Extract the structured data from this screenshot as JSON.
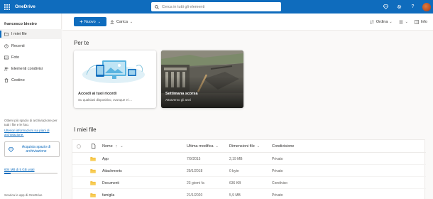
{
  "topbar": {
    "app_name": "OneDrive",
    "search_placeholder": "Cerca in tutti gli elementi",
    "icons": [
      "diamond-icon",
      "gear-icon",
      "help-icon",
      "avatar"
    ],
    "help_label": "?"
  },
  "sidebar": {
    "user_name": "francesco biestro",
    "items": [
      {
        "label": "I miei file",
        "icon": "folder-icon",
        "active": true
      },
      {
        "label": "Recenti",
        "icon": "clock-icon",
        "active": false
      },
      {
        "label": "Foto",
        "icon": "photo-icon",
        "active": false
      },
      {
        "label": "Elementi condivisi",
        "icon": "people-icon",
        "active": false
      },
      {
        "label": "Cestino",
        "icon": "trash-icon",
        "active": false
      }
    ],
    "storage_text": "Ottieni più spazio di archiviazione per tutti i file e le foto.",
    "storage_link": "Ulteriori informazioni sui piani di archiviazione.",
    "buy_label": "Acquista spazio di archiviazione",
    "storage_used": "604 MB di 5 GB usati",
    "storage_fraction": 0.12,
    "get_apps": "Scarica le app di OneDrive"
  },
  "commandbar": {
    "new_label": "Nuovo",
    "upload_label": "Carica",
    "sort_label": "Ordina",
    "info_label": "Info",
    "chevron": "⌄"
  },
  "for_you": {
    "heading": "Per te",
    "cards": [
      {
        "title": "Accedi ai tuoi ricordi",
        "subtitle": "Su qualsiasi dispositivo, ovunque e i..."
      },
      {
        "title": "Settimana scorsa",
        "subtitle": "Attraverso gli anni"
      }
    ]
  },
  "my_files": {
    "heading": "I miei file",
    "columns": {
      "name": "Nome",
      "sort_arrow": "↑",
      "modified": "Ultima modifica",
      "size": "Dimensioni file",
      "sharing": "Condivisione"
    },
    "rows": [
      {
        "name": "App",
        "modified": "7/9/2015",
        "size": "2,19 MB",
        "sharing": "Privato"
      },
      {
        "name": "Attachments",
        "modified": "29/1/2018",
        "size": "0 byte",
        "sharing": "Privato"
      },
      {
        "name": "Documenti",
        "modified": "23 giorni fa",
        "size": "636 KB",
        "sharing": "Condiviso"
      },
      {
        "name": "famiglia",
        "modified": "21/1/2020",
        "size": "5,9 MB",
        "sharing": "Privato"
      }
    ]
  },
  "colors": {
    "accent": "#0f6cbd",
    "folder": "#f0b72f"
  }
}
